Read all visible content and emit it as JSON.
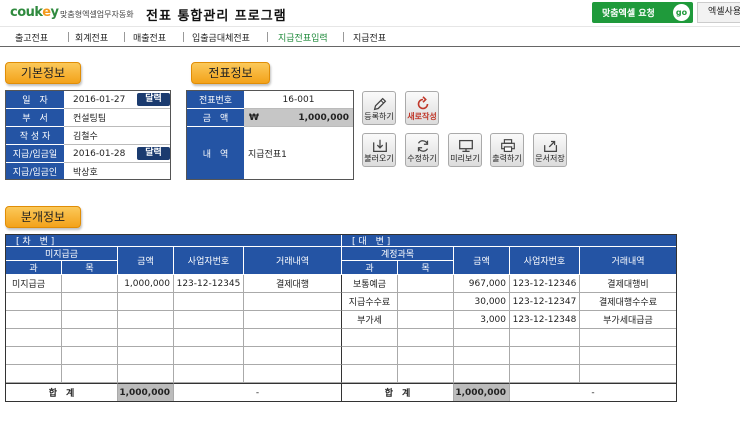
{
  "header": {
    "logo_main": "couk",
    "logo_accent": "e",
    "logo_tail": "y",
    "brand_sub": "맞춤형엑셀업무자동화",
    "title": "전표 통합관리 프로그램",
    "request_label": "맞춤엑셀 요청",
    "go_label": "go",
    "excel_label": "엑셀사용"
  },
  "menu": [
    {
      "label": "출고전표"
    },
    {
      "label": "회계전표"
    },
    {
      "label": "매출전표"
    },
    {
      "label": "입출금대체전표"
    },
    {
      "label": "지급전표입력"
    },
    {
      "label": "지급전표"
    }
  ],
  "basic": {
    "title": "기본정보",
    "fields": [
      {
        "label": "일　자",
        "value": "2016-01-27"
      },
      {
        "label": "부　서",
        "value": "컨설팅팀"
      },
      {
        "label": "작 성 자",
        "value": "김철수"
      },
      {
        "label": "지급/입금일",
        "value": "2016-01-28"
      },
      {
        "label": "지급/입금인",
        "value": "박상호"
      }
    ],
    "cal_label": "달력"
  },
  "voucher": {
    "title": "전표정보",
    "no_label": "전표번호",
    "no_value": "16-001",
    "amount_label": "금　액",
    "currency": "₩",
    "amount_value": "1,000,000",
    "content_label": "내　역",
    "content_value": "지급전표1"
  },
  "tools": [
    {
      "label": "등록하기",
      "icon": "pencil-icon"
    },
    {
      "label": "새로작성",
      "icon": "refresh-icon"
    },
    {
      "label": "불러오기",
      "icon": "download-tray-icon"
    },
    {
      "label": "수정하기",
      "icon": "sync-icon"
    },
    {
      "label": "미리보기",
      "icon": "monitor-icon"
    },
    {
      "label": "출력하기",
      "icon": "printer-icon"
    },
    {
      "label": "문서저장",
      "icon": "export-icon"
    }
  ],
  "journal": {
    "title": "분개정보",
    "debit": {
      "header": "[ 차　변 ]",
      "account_group": "미지급금",
      "sub1": "과",
      "sub2": "목",
      "col_amount": "금액",
      "col_bizno": "사업자번호",
      "col_desc": "거래내역",
      "rows": [
        {
          "account": "미지급금",
          "amount": "1,000,000",
          "bizno": "123-12-12345",
          "desc": "결제대행"
        }
      ],
      "total_label": "합　계",
      "total_amount": "1,000,000",
      "total_dash": "-"
    },
    "credit": {
      "header": "[ 대　변 ]",
      "account_group": "계정과목",
      "sub1": "과",
      "sub2": "목",
      "col_amount": "금액",
      "col_bizno": "사업자번호",
      "col_desc": "거래내역",
      "rows": [
        {
          "account": "보통예금",
          "amount": "967,000",
          "bizno": "123-12-12346",
          "desc": "결제대행비"
        },
        {
          "account": "지급수수료",
          "amount": "30,000",
          "bizno": "123-12-12347",
          "desc": "결제대행수수료"
        },
        {
          "account": "부가세",
          "amount": "3,000",
          "bizno": "123-12-12348",
          "desc": "부가세대급금"
        }
      ],
      "total_label": "합　계",
      "total_amount": "1,000,000",
      "total_dash": "-"
    }
  },
  "colors": {
    "accent_green": "#1f9a3b",
    "label_blue": "#2454a4",
    "section_orange": "#f3a21a",
    "new_red": "#c0392b"
  }
}
